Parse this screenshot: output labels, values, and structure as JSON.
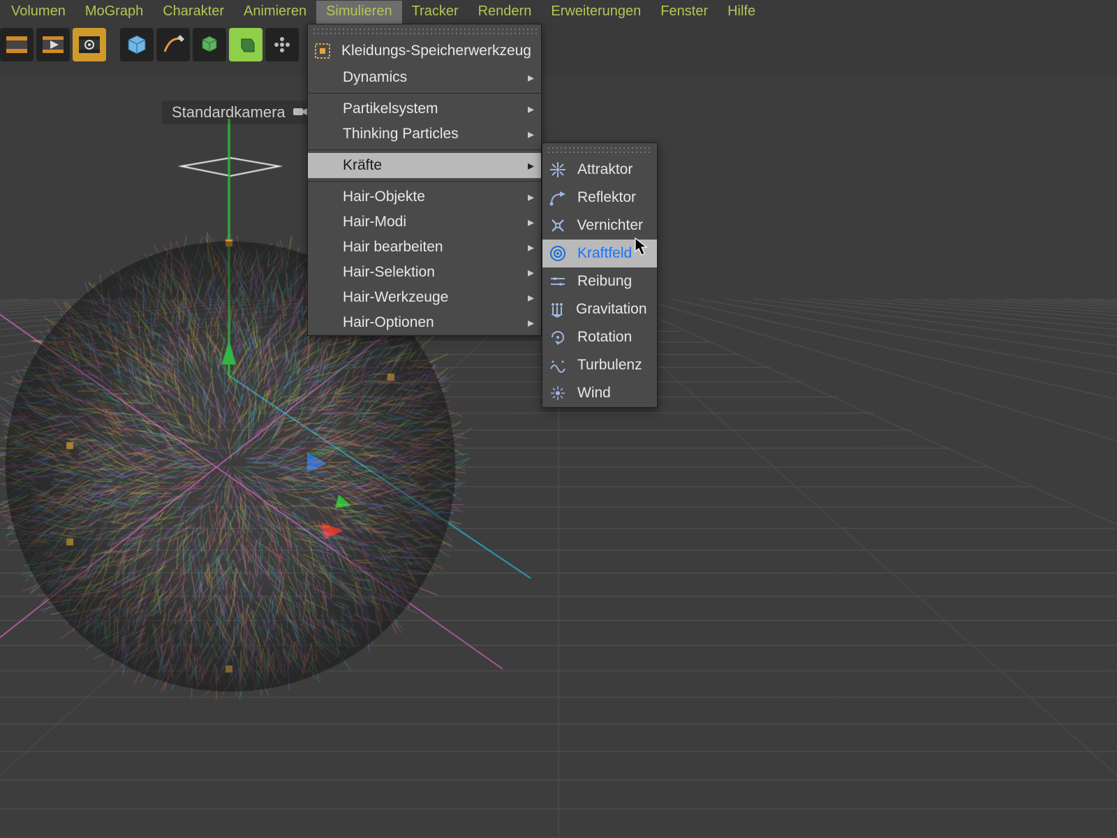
{
  "menubar": {
    "items": [
      {
        "label": "Volumen"
      },
      {
        "label": "MoGraph"
      },
      {
        "label": "Charakter"
      },
      {
        "label": "Animieren"
      },
      {
        "label": "Simulieren",
        "open": true
      },
      {
        "label": "Tracker"
      },
      {
        "label": "Rendern"
      },
      {
        "label": "Erweiterungen"
      },
      {
        "label": "Fenster"
      },
      {
        "label": "Hilfe"
      }
    ]
  },
  "viewport": {
    "camera_label": "Standardkamera"
  },
  "menu_main": {
    "items": [
      {
        "label": "Kleidungs-Speicherwerkzeug",
        "icon": "cloth-cache-icon"
      },
      {
        "label": "Dynamics",
        "sub": true
      },
      {
        "sep": true
      },
      {
        "label": "Partikelsystem",
        "sub": true
      },
      {
        "label": "Thinking Particles",
        "sub": true
      },
      {
        "sep": true
      },
      {
        "label": "Kräfte",
        "sub": true,
        "selected": true
      },
      {
        "sep": true
      },
      {
        "label": "Hair-Objekte",
        "sub": true
      },
      {
        "label": "Hair-Modi",
        "sub": true
      },
      {
        "label": "Hair bearbeiten",
        "sub": true
      },
      {
        "label": "Hair-Selektion",
        "sub": true
      },
      {
        "label": "Hair-Werkzeuge",
        "sub": true
      },
      {
        "label": "Hair-Optionen",
        "sub": true
      }
    ]
  },
  "menu_sub": {
    "items": [
      {
        "label": "Attraktor",
        "icon": "attractor-icon"
      },
      {
        "label": "Reflektor",
        "icon": "deflector-icon"
      },
      {
        "label": "Vernichter",
        "icon": "destructor-icon"
      },
      {
        "label": "Kraftfeld",
        "icon": "forcefield-icon",
        "hover": true
      },
      {
        "label": "Reibung",
        "icon": "friction-icon"
      },
      {
        "label": "Gravitation",
        "icon": "gravity-icon"
      },
      {
        "label": "Rotation",
        "icon": "rotation-icon"
      },
      {
        "label": "Turbulenz",
        "icon": "turbulence-icon"
      },
      {
        "label": "Wind",
        "icon": "wind-icon"
      }
    ]
  },
  "toolbar": {
    "buttons": [
      {
        "name": "timeline-record-icon"
      },
      {
        "name": "timeline-play-icon"
      },
      {
        "name": "render-settings-icon",
        "selected": true
      },
      {
        "name": "cube-primitive-icon"
      },
      {
        "name": "spline-pen-icon"
      },
      {
        "name": "generator-icon"
      },
      {
        "name": "extrude-icon",
        "green": true
      },
      {
        "name": "array-icon"
      }
    ]
  }
}
